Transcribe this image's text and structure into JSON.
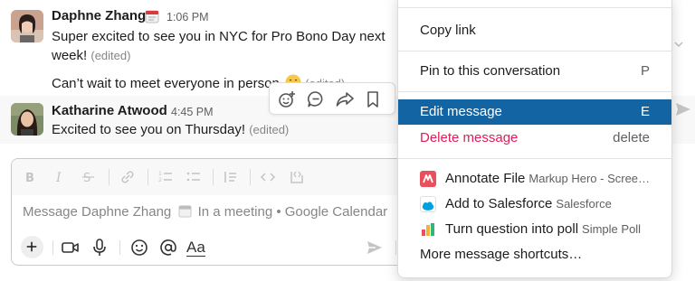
{
  "messages": [
    {
      "author": "Daphne Zhang",
      "time": "1:06 PM",
      "lines": [
        "Super excited to see you in NYC for Pro Bono Day next",
        "week!"
      ],
      "edited": "(edited)",
      "line3": "Can’t wait to meet everyone in person",
      "line3_edited": "(edited)"
    },
    {
      "author": "Katharine Atwood",
      "time": "4:45 PM",
      "text": "Excited to see you on Thursday!",
      "edited": "(edited)"
    }
  ],
  "hover_actions": [
    "add-reaction-icon",
    "reply-thread-icon",
    "share-icon",
    "bookmark-icon"
  ],
  "composer": {
    "placeholder": "Message Daphne Zhang",
    "placeholder_status": "In a meeting • Google Calendar",
    "format_icons": [
      "bold-icon",
      "italic-icon",
      "strikethrough-icon",
      "link-icon",
      "ordered-list-icon",
      "bulleted-list-icon",
      "blockquote-icon",
      "code-icon",
      "code-block-icon"
    ],
    "toolbar_text_format": "Aa"
  },
  "menu": {
    "copy_link": "Copy link",
    "pin": {
      "label": "Pin to this conversation",
      "shortcut": "P"
    },
    "edit": {
      "label": "Edit message",
      "shortcut": "E"
    },
    "delete": {
      "label": "Delete message",
      "shortcut": "delete"
    },
    "apps": [
      {
        "label": "Annotate File",
        "app": "Markup Hero - Scree…",
        "color": "#e8505b"
      },
      {
        "label": "Add to Salesforce",
        "app": "Salesforce",
        "color": "#00a1e0"
      },
      {
        "label": "Turn question into poll",
        "app": "Simple Poll",
        "color": "#f2b138"
      }
    ],
    "more": "More message shortcuts…"
  },
  "colors": {
    "accent_selected": "#1264a3",
    "danger": "#e01e5a"
  }
}
